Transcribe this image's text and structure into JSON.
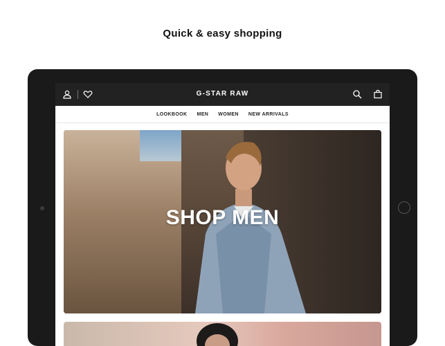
{
  "promo": {
    "title": "Quick & easy shopping"
  },
  "header": {
    "logo": "G-STAR RAW",
    "icons": [
      "user-icon",
      "heart-icon",
      "search-icon",
      "bag-icon"
    ]
  },
  "nav": {
    "items": [
      {
        "label": "LOOKBOOK"
      },
      {
        "label": "MEN"
      },
      {
        "label": "WOMEN"
      },
      {
        "label": "NEW ARRIVALS"
      }
    ]
  },
  "hero": {
    "label": "SHOP MEN"
  },
  "colors": {
    "header_bg": "#222222",
    "text_light": "#ffffff"
  }
}
